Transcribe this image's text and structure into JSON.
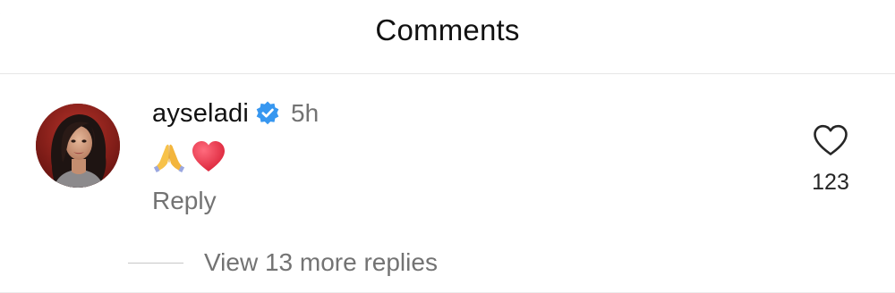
{
  "header": {
    "title": "Comments"
  },
  "comment": {
    "username": "ayseladi",
    "verified_icon": "verified-badge-icon",
    "timestamp": "5h",
    "emojis": [
      "folded-hands-emoji",
      "red-heart-emoji"
    ],
    "reply_label": "Reply",
    "like_icon": "heart-outline-icon",
    "like_count": "123"
  },
  "replies": {
    "view_label": "View 13 more replies"
  },
  "colors": {
    "text_primary": "#111111",
    "text_secondary": "#737373",
    "verified_blue": "#3797f0",
    "heart_red": "#e0263b",
    "divider": "#e6e6e6"
  }
}
